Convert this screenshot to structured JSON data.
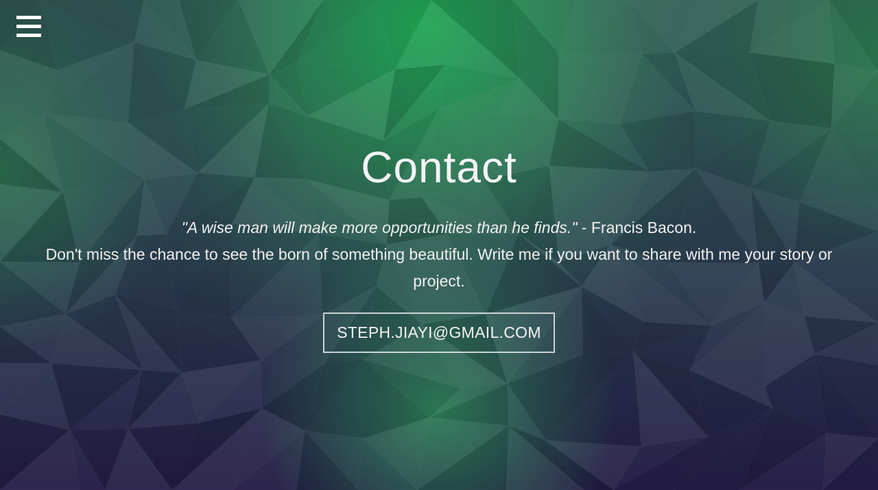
{
  "header": {
    "menu_icon": "hamburger-menu-icon"
  },
  "main": {
    "title": "Contact",
    "quote": "\"A wise man will make more opportunities than he finds.\"",
    "quote_author": " - Francis Bacon.",
    "description": "Don't miss the chance to see the born of something beautiful. Write me if you want to share with me your story or project.",
    "email_button_label": "STEPH.JIAYI@GMAIL.COM"
  },
  "colors": {
    "accent_green": "#22a455",
    "deep_purple": "#241c46",
    "text": "#f2f2f2"
  }
}
